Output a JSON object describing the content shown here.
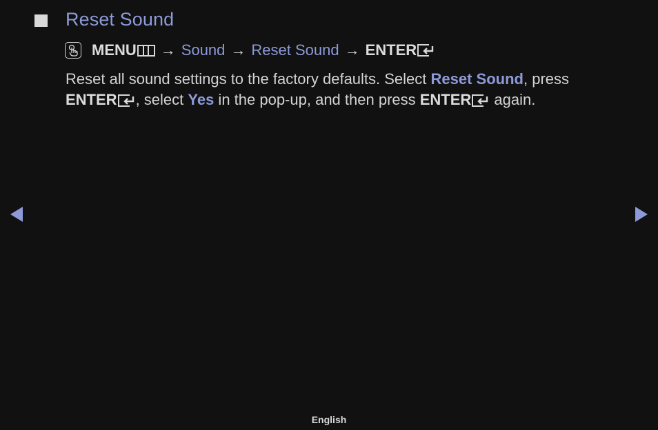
{
  "section": {
    "bullet_icon": "square-bullet-icon",
    "title": "Reset Sound"
  },
  "path": {
    "hand_icon": "remote-touch-icon",
    "menu_label": "MENU",
    "menu_icon": "menu-icon",
    "arrow": "→",
    "sound_label": "Sound",
    "reset_sound_label": "Reset Sound",
    "enter_label": "ENTER",
    "enter_icon": "enter-icon"
  },
  "description": {
    "part1": "Reset all sound settings to the factory defaults. Select ",
    "link1": "Reset Sound",
    "part2": ", press ",
    "enter1": "ENTER",
    "part3": ", select ",
    "link2": "Yes",
    "part4": " in the pop-up, and then press ",
    "enter2": "ENTER",
    "part5": " again."
  },
  "navigation": {
    "prev_icon": "previous-page-icon",
    "next_icon": "next-page-icon"
  },
  "footer": {
    "language": "English"
  },
  "colors": {
    "background": "#111111",
    "accent": "#8d9ad8",
    "text": "#d8d8d8"
  }
}
